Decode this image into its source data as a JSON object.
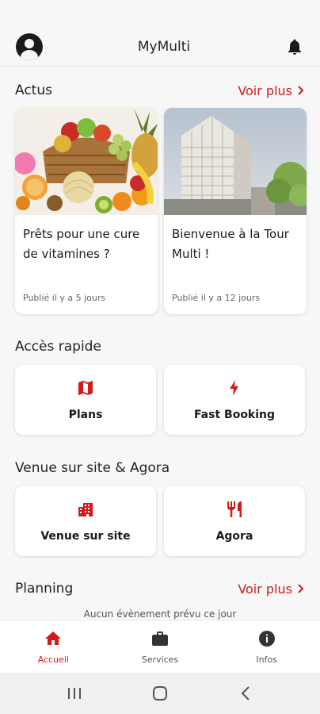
{
  "header": {
    "title": "MyMulti",
    "profile_icon": "account-circle-icon",
    "notification_icon": "bell-icon"
  },
  "news": {
    "title": "Actus",
    "see_more": "Voir plus",
    "items": [
      {
        "title": "Prêts pour une cure de vitamines ?",
        "date": "Publié il y a 5 jours",
        "image": "fruits-photo"
      },
      {
        "title": "Bienvenue à la Tour Multi !",
        "date": "Publié il y a 12 jours",
        "image": "tower-photo"
      }
    ]
  },
  "quick_access": {
    "title": "Accès rapide",
    "items": [
      {
        "label": "Plans",
        "icon": "map-icon"
      },
      {
        "label": "Fast Booking",
        "icon": "lightning-icon"
      }
    ]
  },
  "venue": {
    "title": "Venue sur site & Agora",
    "items": [
      {
        "label": "Venue sur site",
        "icon": "building-icon"
      },
      {
        "label": "Agora",
        "icon": "restaurant-icon"
      }
    ]
  },
  "planning": {
    "title": "Planning",
    "see_more": "Voir plus",
    "empty_message": "Aucun évènement prévu ce jour"
  },
  "bottom_nav": {
    "items": [
      {
        "label": "Accueil",
        "icon": "home-icon",
        "active": true
      },
      {
        "label": "Services",
        "icon": "briefcase-icon",
        "active": false
      },
      {
        "label": "Infos",
        "icon": "info-icon",
        "active": false
      }
    ]
  },
  "colors": {
    "accent": "#d21c1c",
    "text": "#222222",
    "background": "#f7f7f7",
    "card": "#ffffff"
  }
}
